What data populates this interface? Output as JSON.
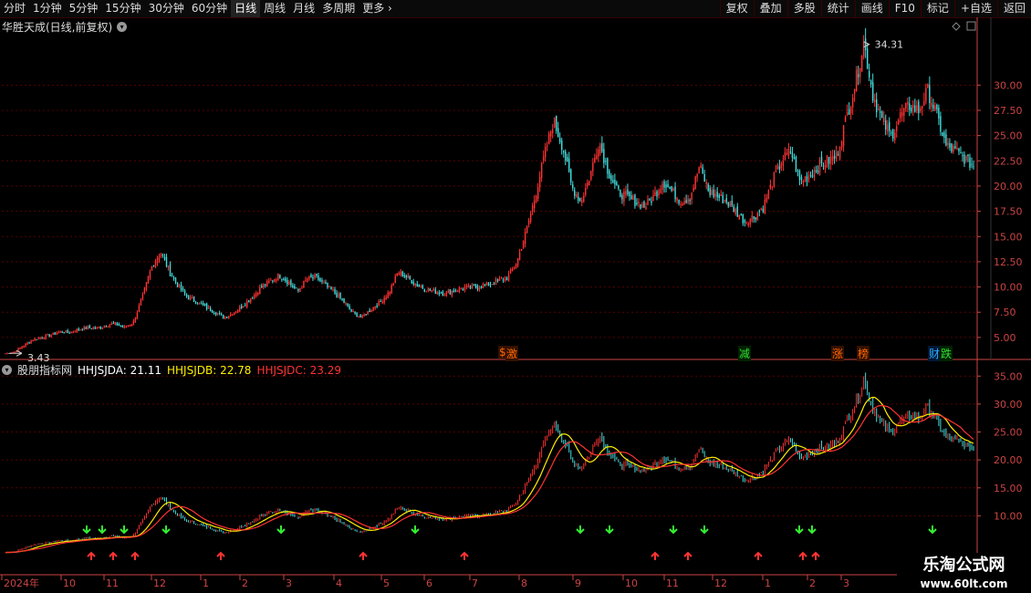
{
  "toolbar": {
    "periods": [
      "分时",
      "1分钟",
      "5分钟",
      "15分钟",
      "30分钟",
      "60分钟",
      "日线",
      "周线",
      "月线",
      "多周期",
      "更多"
    ],
    "active": "日线",
    "right_buttons": [
      "复权",
      "叠加",
      "多股",
      "统计",
      "画线",
      "F10",
      "标记",
      "+自选",
      "返回"
    ]
  },
  "main": {
    "title": "华胜天成(日线,前复权)",
    "high_label": "34.31",
    "low_label": "3.43"
  },
  "indicator": {
    "name": "股朋指标网",
    "a_label": "HHJSJDA: 21.11",
    "b_label": "HHJSJDB: 22.78",
    "c_label": "HHJSJDC: 23.29",
    "colors": {
      "a": "#ffffff",
      "b": "#ffee00",
      "c": "#ff3333"
    }
  },
  "events": [
    "$",
    "激",
    "减",
    "涨",
    "榜",
    "财",
    "跌"
  ],
  "date_axis": [
    "2024年",
    "10",
    "11",
    "12",
    "1",
    "2",
    "3",
    "4",
    "5",
    "6",
    "7",
    "8",
    "9",
    "10",
    "11",
    "12",
    "1",
    "2",
    "3"
  ],
  "brand": {
    "line1": "乐淘公式网",
    "line2": "www.60lt.com"
  },
  "colors": {
    "up": "#ff3333",
    "down": "#44dddd",
    "grid": "#5a0000",
    "axis": "#cc4444"
  },
  "chart_data": [
    {
      "type": "candlestick",
      "title": "华胜天成(日线,前复权)",
      "y_ticks": [
        5.0,
        7.5,
        10.0,
        12.5,
        15.0,
        17.5,
        20.0,
        22.5,
        25.0,
        27.5,
        30.0
      ],
      "ylim": [
        3.0,
        35.0
      ],
      "price_path": [
        3.43,
        3.6,
        4.2,
        4.8,
        5.0,
        5.3,
        5.6,
        5.5,
        5.8,
        6.0,
        5.9,
        6.2,
        6.4,
        6.0,
        6.5,
        9.0,
        12.0,
        13.5,
        11.5,
        10.0,
        9.0,
        8.5,
        8.0,
        7.5,
        7.0,
        7.5,
        8.2,
        9.0,
        10.0,
        10.6,
        11.2,
        10.5,
        9.6,
        10.8,
        11.0,
        10.2,
        9.5,
        8.6,
        7.5,
        7.0,
        7.8,
        8.5,
        9.5,
        11.5,
        11.0,
        10.3,
        9.8,
        9.6,
        9.4,
        9.6,
        9.9,
        10.0,
        10.1,
        10.3,
        10.6,
        11.0,
        12.5,
        15.5,
        19.0,
        23.0,
        26.5,
        24.0,
        20.0,
        18.5,
        21.0,
        24.5,
        21.5,
        19.5,
        19.0,
        18.5,
        18.0,
        19.0,
        20.5,
        19.5,
        18.5,
        19.0,
        22.0,
        19.5,
        19.0,
        18.5,
        17.5,
        16.5,
        17.0,
        18.0,
        20.5,
        22.5,
        23.5,
        20.5,
        21.0,
        22.0,
        22.5,
        23.0,
        26.5,
        30.0,
        34.31,
        29.0,
        26.5,
        25.0,
        27.0,
        28.0,
        27.5,
        29.5,
        27.0,
        24.0,
        23.5,
        22.8,
        22.0
      ]
    },
    {
      "type": "line",
      "title": "股朋指标网",
      "series": [
        {
          "name": "HHJSJDA"
        },
        {
          "name": "HHJSJDB"
        },
        {
          "name": "HHJSJDC"
        }
      ],
      "last_values": {
        "HHJSJDA": 21.11,
        "HHJSJDB": 22.78,
        "HHJSJDC": 23.29
      },
      "y_ticks": [
        10.0,
        15.0,
        20.0,
        25.0,
        30.0,
        35.0
      ],
      "ylim": [
        5.0,
        37.0
      ]
    }
  ]
}
